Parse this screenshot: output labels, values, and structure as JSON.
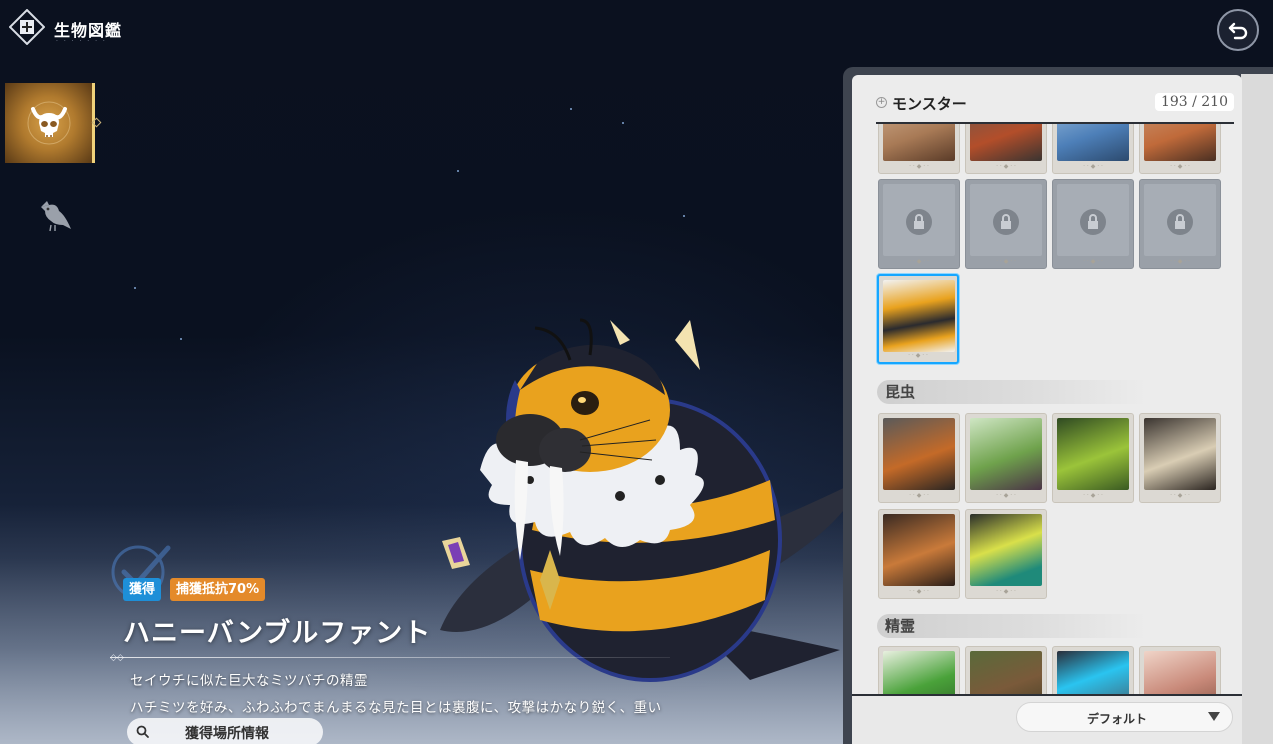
{
  "header": {
    "title": "生物図鑑",
    "logo_icon": "encyclopedia-book-icon",
    "back_icon": "return-arrow-icon"
  },
  "categories": [
    {
      "icon": "monster-skull-icon",
      "selected": true
    },
    {
      "icon": "bird-icon",
      "selected": false
    }
  ],
  "creature": {
    "status_badge": "獲得",
    "capture_badge": "捕獲抵抗70%",
    "name": "ハニーバンブルファント",
    "description_1": "セイウチに似た巨大なミツバチの精霊",
    "description_2": "ハチミツを好み、ふわふわでまんまるな見た目とは裏腹に、攻撃はかなり鋭く、重い",
    "location_button": "獲得場所情報"
  },
  "panel": {
    "section_title": "モンスター",
    "section_count": "193 / 210",
    "group_insect": "昆虫",
    "group_spirit": "精霊",
    "sort_label": "デフォルト"
  },
  "colors": {
    "selected_border": "#16a6ff",
    "obtained_badge": "#1e8fd8",
    "capture_badge": "#e48a2a",
    "tab_gold": "#d7a14a"
  }
}
